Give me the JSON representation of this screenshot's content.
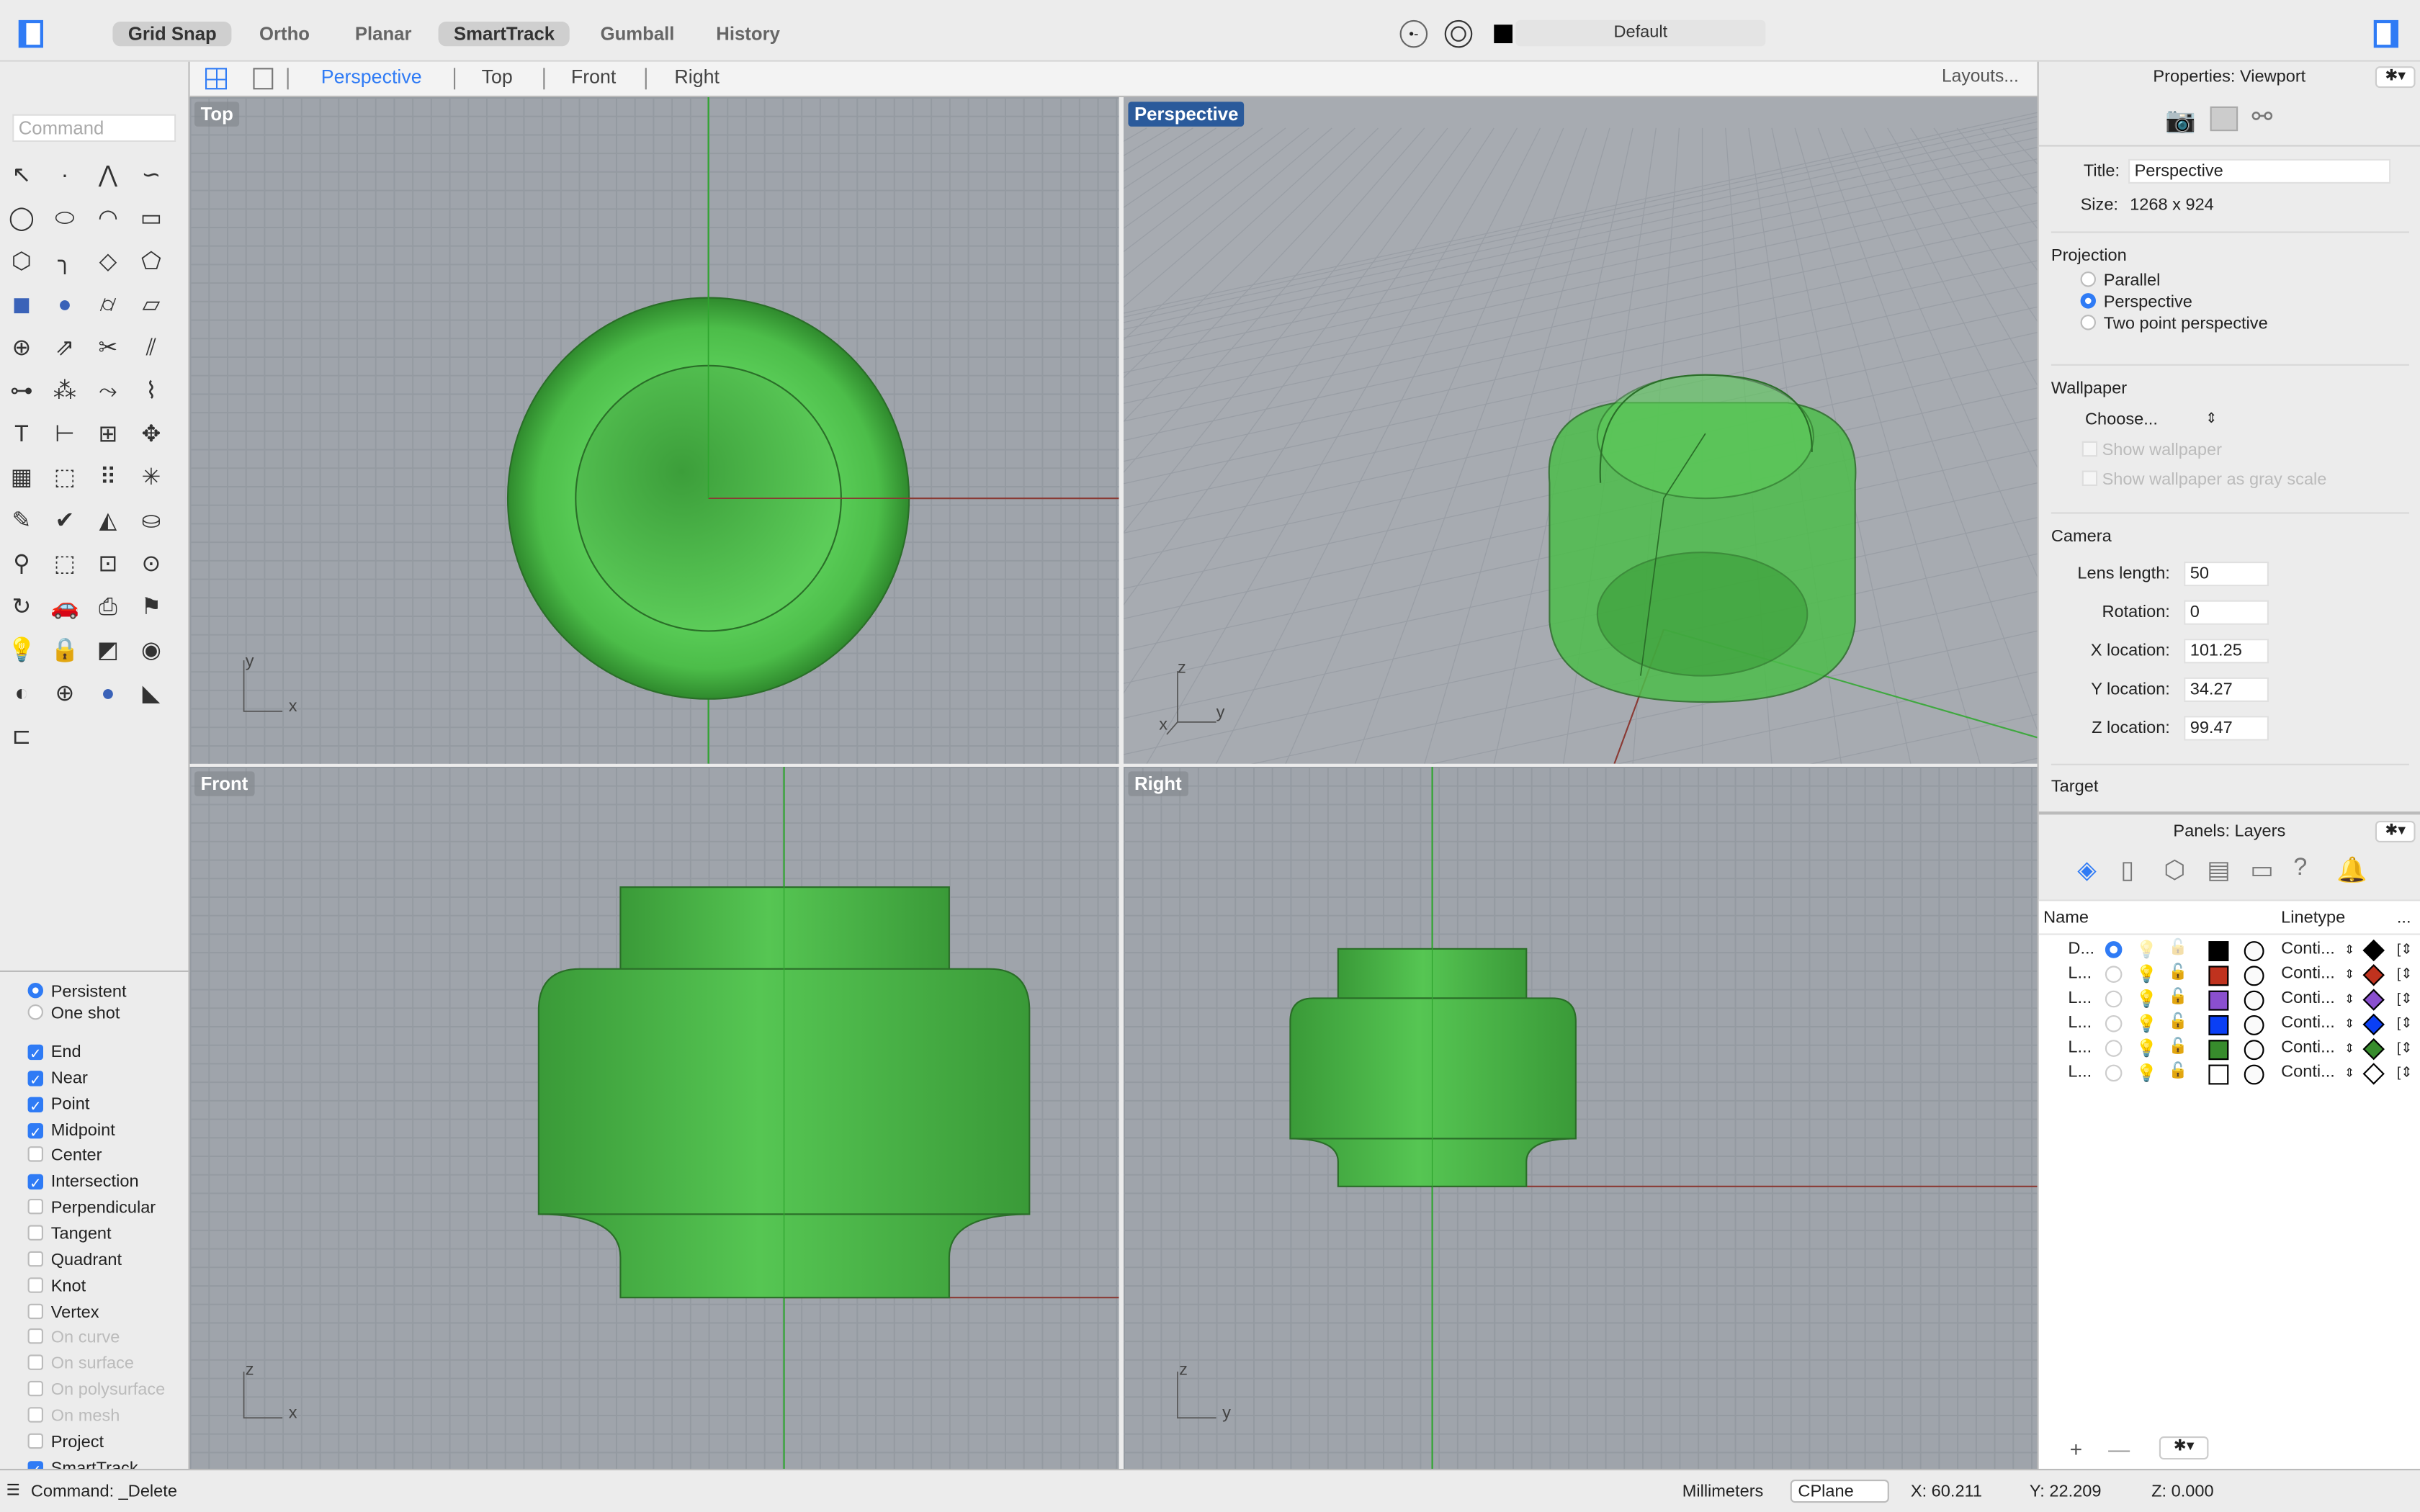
{
  "toolbar": {
    "buttons": [
      {
        "label": "Grid Snap",
        "on": true
      },
      {
        "label": "Ortho",
        "on": false
      },
      {
        "label": "Planar",
        "on": false
      },
      {
        "label": "SmartTrack",
        "on": true
      },
      {
        "label": "Gumball",
        "on": false
      },
      {
        "label": "History",
        "on": false
      }
    ],
    "layer": "Default"
  },
  "viewport_tabs": {
    "tabs": [
      "Perspective",
      "Top",
      "Front",
      "Right"
    ],
    "active": "Perspective",
    "layouts": "Layouts..."
  },
  "command": {
    "placeholder": "Command",
    "status": "Command: _Delete"
  },
  "tools": [
    "pointer-icon",
    "point-icon",
    "polyline-icon",
    "curve-icon",
    "circle-icon",
    "ellipse-icon",
    "arc-icon",
    "rectangle-icon",
    "polygon-icon",
    "fillet-curve-icon",
    "surface-icon",
    "patch-icon",
    "box-icon",
    "sphere-icon",
    "cylinder-icon",
    "plane-icon",
    "boolean-icon",
    "extrude-icon",
    "trim-icon",
    "split-icon",
    "join-icon",
    "group-icon",
    "offset-icon",
    "blend-icon",
    "text-icon",
    "dimension-icon",
    "array-icon",
    "move-icon",
    "mesh-icon",
    "extract-icon",
    "grid-array-icon",
    "explode-icon",
    "edit-icon",
    "check-icon",
    "analyze-icon",
    "paint-icon",
    "zoom-icon",
    "zoom-window-icon",
    "zoom-extents-icon",
    "zoom-selected-icon",
    "rotate-view-icon",
    "car-icon",
    "snapshot-icon",
    "named-view-icon",
    "light-icon",
    "lock-icon",
    "material-icon",
    "color-wheel-icon",
    "render-icon",
    "grid-sphere-icon",
    "shaded-sphere-icon",
    "cone-light-icon",
    "cplane-icon"
  ],
  "snaps": {
    "modes": [
      {
        "label": "Persistent",
        "on": true
      },
      {
        "label": "One shot",
        "on": false
      }
    ],
    "items": [
      {
        "label": "End",
        "on": true
      },
      {
        "label": "Near",
        "on": true
      },
      {
        "label": "Point",
        "on": true
      },
      {
        "label": "Midpoint",
        "on": true
      },
      {
        "label": "Center",
        "on": false
      },
      {
        "label": "Intersection",
        "on": true
      },
      {
        "label": "Perpendicular",
        "on": false
      },
      {
        "label": "Tangent",
        "on": false
      },
      {
        "label": "Quadrant",
        "on": false
      },
      {
        "label": "Knot",
        "on": false
      },
      {
        "label": "Vertex",
        "on": false
      },
      {
        "label": "On curve",
        "on": false,
        "disabled": true
      },
      {
        "label": "On surface",
        "on": false,
        "disabled": true
      },
      {
        "label": "On polysurface",
        "on": false,
        "disabled": true
      },
      {
        "label": "On mesh",
        "on": false,
        "disabled": true
      },
      {
        "label": "Project",
        "on": false
      },
      {
        "label": "SmartTrack",
        "on": true
      }
    ]
  },
  "viewports": {
    "top": "Top",
    "perspective": "Perspective",
    "front": "Front",
    "right": "Right",
    "axis": {
      "x": "x",
      "y": "y",
      "z": "z"
    }
  },
  "properties": {
    "header": "Properties: Viewport",
    "title_label": "Title:",
    "title_value": "Perspective",
    "size_label": "Size:",
    "size_value": "1268 x 924",
    "projection": "Projection",
    "proj_options": [
      {
        "label": "Parallel",
        "on": false
      },
      {
        "label": "Perspective",
        "on": true
      },
      {
        "label": "Two point perspective",
        "on": false
      }
    ],
    "wallpaper": "Wallpaper",
    "choose": "Choose...",
    "show_wallpaper": "Show wallpaper",
    "gray_scale": "Show wallpaper as gray scale",
    "camera": "Camera",
    "fields": [
      {
        "label": "Lens length:",
        "value": "50"
      },
      {
        "label": "Rotation:",
        "value": "0"
      },
      {
        "label": "X location:",
        "value": "101.25"
      },
      {
        "label": "Y location:",
        "value": "34.27"
      },
      {
        "label": "Z location:",
        "value": "99.47"
      }
    ],
    "target": "Target"
  },
  "layers": {
    "header": "Panels: Layers",
    "columns": {
      "name": "Name",
      "linetype": "Linetype",
      "more": "..."
    },
    "rows": [
      {
        "name": "D...",
        "current": true,
        "color": "#000000",
        "linetype": "Conti..."
      },
      {
        "name": "L...",
        "current": false,
        "color": "#c0321e",
        "linetype": "Conti..."
      },
      {
        "name": "L...",
        "current": false,
        "color": "#8a4fcf",
        "linetype": "Conti..."
      },
      {
        "name": "L...",
        "current": false,
        "color": "#0a3ff5",
        "linetype": "Conti..."
      },
      {
        "name": "L...",
        "current": false,
        "color": "#378c2c",
        "linetype": "Conti..."
      },
      {
        "name": "L...",
        "current": false,
        "color": "#ffffff",
        "linetype": "Conti..."
      }
    ]
  },
  "status": {
    "units": "Millimeters",
    "cplane": "CPlane",
    "x": "X: 60.211",
    "y": "Y: 22.209",
    "z": "Z: 0.000"
  },
  "colors": {
    "accent": "#2f7bf5",
    "model_green": "#4cc04a",
    "viewport_bg": "#9fa4ab"
  }
}
